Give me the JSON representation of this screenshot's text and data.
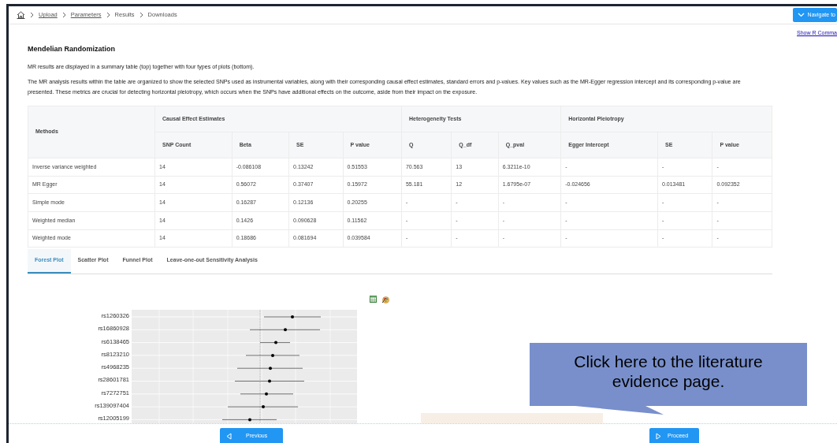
{
  "breadcrumb": [
    {
      "label": "Upload",
      "link": true
    },
    {
      "label": "Parameters",
      "link": true
    },
    {
      "label": "Results",
      "link": false
    },
    {
      "label": "Downloads",
      "link": false
    }
  ],
  "navigate_button": {
    "label": "Navigate to"
  },
  "r_command_link": "Show R Comma",
  "title": "Mendelian Randomization",
  "paragraphs": [
    "MR results are displayed in a summary table (top) together with four types of plots (bottom).",
    "The MR analysis results within the table are organized to show the selected SNPs used as instrumental variables, along with their corresponding causal effect estimates, standard errors and p-values. Key values such as the MR-Egger regression intercept and its corresponding p-value are presented. These metrics are crucial for detecting horizontal pleiotropy, which occurs when the SNPs have additional effects on the outcome, aside from their impact on the exposure."
  ],
  "table": {
    "methods_header": "Methods",
    "groups": [
      {
        "label": "Causal Effect Estimates",
        "columns": [
          "SNP Count",
          "Beta",
          "SE",
          "P value"
        ]
      },
      {
        "label": "Heterogeneity Tests",
        "columns": [
          "Q",
          "Q_df",
          "Q_pval"
        ]
      },
      {
        "label": "Horizontal Pleiotropy",
        "columns": [
          "Egger Intercept",
          "SE",
          "P value"
        ]
      }
    ],
    "rows": [
      {
        "method": "Inverse variance weighted",
        "values": [
          "14",
          "-0.086108",
          "0.13242",
          "0.51553",
          "70.563",
          "13",
          "6.3211e-10",
          "-",
          "-",
          "-"
        ]
      },
      {
        "method": "MR Egger",
        "values": [
          "14",
          "0.56072",
          "0.37407",
          "0.15972",
          "55.181",
          "12",
          "1.6795e-07",
          "-0.024656",
          "0.013481",
          "0.092352"
        ]
      },
      {
        "method": "Simple mode",
        "values": [
          "14",
          "0.16287",
          "0.12136",
          "0.20255",
          "-",
          "-",
          "-",
          "-",
          "-",
          "-"
        ]
      },
      {
        "method": "Weighted median",
        "values": [
          "14",
          "0.1426",
          "0.090628",
          "0.11562",
          "-",
          "-",
          "-",
          "-",
          "-",
          "-"
        ]
      },
      {
        "method": "Weighted mode",
        "values": [
          "14",
          "0.18686",
          "0.081694",
          "0.039584",
          "-",
          "-",
          "-",
          "-",
          "-",
          "-"
        ]
      }
    ]
  },
  "tabs": [
    {
      "label": "Forest Plot",
      "selected": true
    },
    {
      "label": "Scatter Plot",
      "selected": false
    },
    {
      "label": "Funnel Plot",
      "selected": false
    },
    {
      "label": "Leave-one-out Sensitivity Analysis",
      "selected": false
    }
  ],
  "forest_plot": {
    "snps": [
      "rs1260326",
      "rs16860928",
      "rs6138465",
      "rs8123210",
      "rs4968235",
      "rs28601781",
      "rs7272751",
      "rs139097404",
      "rs12005199"
    ]
  },
  "callout": {
    "text": "Click here to the literature evidence page."
  },
  "footer_buttons": [
    {
      "kind": "previous",
      "label": "Previous"
    },
    {
      "kind": "proceed",
      "label": "Proceed"
    }
  ]
}
